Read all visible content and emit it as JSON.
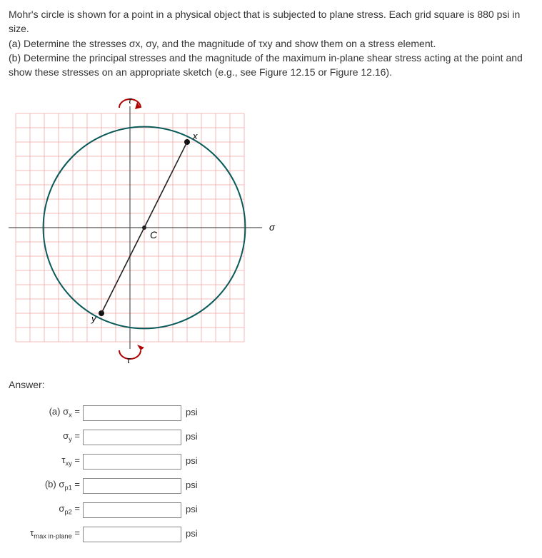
{
  "problem": {
    "intro": "Mohr's circle is shown for a point in a physical object that is subjected to plane stress.  Each grid square is 880 psi in size.",
    "partA_full": "(a) Determine the stresses σx, σy, and the magnitude of τxy and show them on a stress element.",
    "partB_full": "(b) Determine the principal stresses and the magnitude of the maximum in-plane shear stress acting at the point and show these stresses on an appropriate sketch (e.g., see Figure 12.15 or Figure 12.16)."
  },
  "diagram": {
    "tau_symbol": "τ",
    "sigma_symbol": "σ",
    "x_label": "x",
    "y_label": "y",
    "C_label": "C",
    "grid_unit_psi": 880
  },
  "answer_heading": "Answer:",
  "fields": {
    "sigma_x": {
      "label_prefix": "(a) σ",
      "label_sub": "x",
      "label_suffix": " =",
      "unit": "psi"
    },
    "sigma_y": {
      "label_prefix": "σ",
      "label_sub": "y",
      "label_suffix": " =",
      "unit": "psi"
    },
    "tau_xy": {
      "label_prefix": "τ",
      "label_sub": "xy",
      "label_suffix": " =",
      "unit": "psi"
    },
    "sigma_p1": {
      "label_prefix": "(b) σ",
      "label_sub": "p1",
      "label_suffix": " =",
      "unit": "psi"
    },
    "sigma_p2": {
      "label_prefix": "σ",
      "label_sub": "p2",
      "label_suffix": " =",
      "unit": "psi"
    },
    "tau_max": {
      "label_prefix": "τ",
      "label_sub": "max in-plane",
      "label_suffix": " =",
      "unit": "psi"
    }
  }
}
